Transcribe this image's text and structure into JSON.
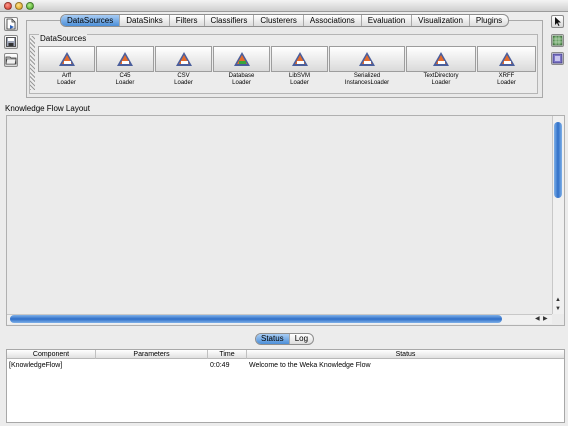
{
  "toolbar_tabs": [
    {
      "label": "DataSources",
      "active": true
    },
    {
      "label": "DataSinks",
      "active": false
    },
    {
      "label": "Filters",
      "active": false
    },
    {
      "label": "Classifiers",
      "active": false
    },
    {
      "label": "Clusterers",
      "active": false
    },
    {
      "label": "Associations",
      "active": false
    },
    {
      "label": "Evaluation",
      "active": false
    },
    {
      "label": "Visualization",
      "active": false
    },
    {
      "label": "Plugins",
      "active": false
    }
  ],
  "datasources": {
    "title": "DataSources",
    "loaders": [
      {
        "line1": "Arff",
        "line2": "Loader"
      },
      {
        "line1": "C45",
        "line2": "Loader"
      },
      {
        "line1": "CSV",
        "line2": "Loader"
      },
      {
        "line1": "Database",
        "line2": "Loader"
      },
      {
        "line1": "LibSVM",
        "line2": "Loader"
      },
      {
        "line1": "Serialized",
        "line2": "InstancesLoader"
      },
      {
        "line1": "TextDirectory",
        "line2": "Loader"
      },
      {
        "line1": "XRFF",
        "line2": "Loader"
      }
    ]
  },
  "layout": {
    "title": "Knowledge Flow Layout"
  },
  "status_tabs": [
    {
      "label": "Status",
      "active": true
    },
    {
      "label": "Log",
      "active": false
    }
  ],
  "status_table": {
    "columns": [
      "Component",
      "Parameters",
      "Time",
      "Status"
    ],
    "rows": [
      {
        "component": "[KnowledgeFlow]",
        "parameters": "",
        "time": "0:0:49",
        "status": "Welcome to the Weka Knowledge Flow"
      }
    ]
  },
  "left_tools": [
    "new-flow-icon",
    "save-icon",
    "open-folder-icon"
  ],
  "right_tools": [
    "pointer-icon",
    "snap-grid-icon",
    "layout-icon"
  ],
  "colors": {
    "accent": "#4c8fd8",
    "scroll_thumb": "#2f6fc8"
  }
}
